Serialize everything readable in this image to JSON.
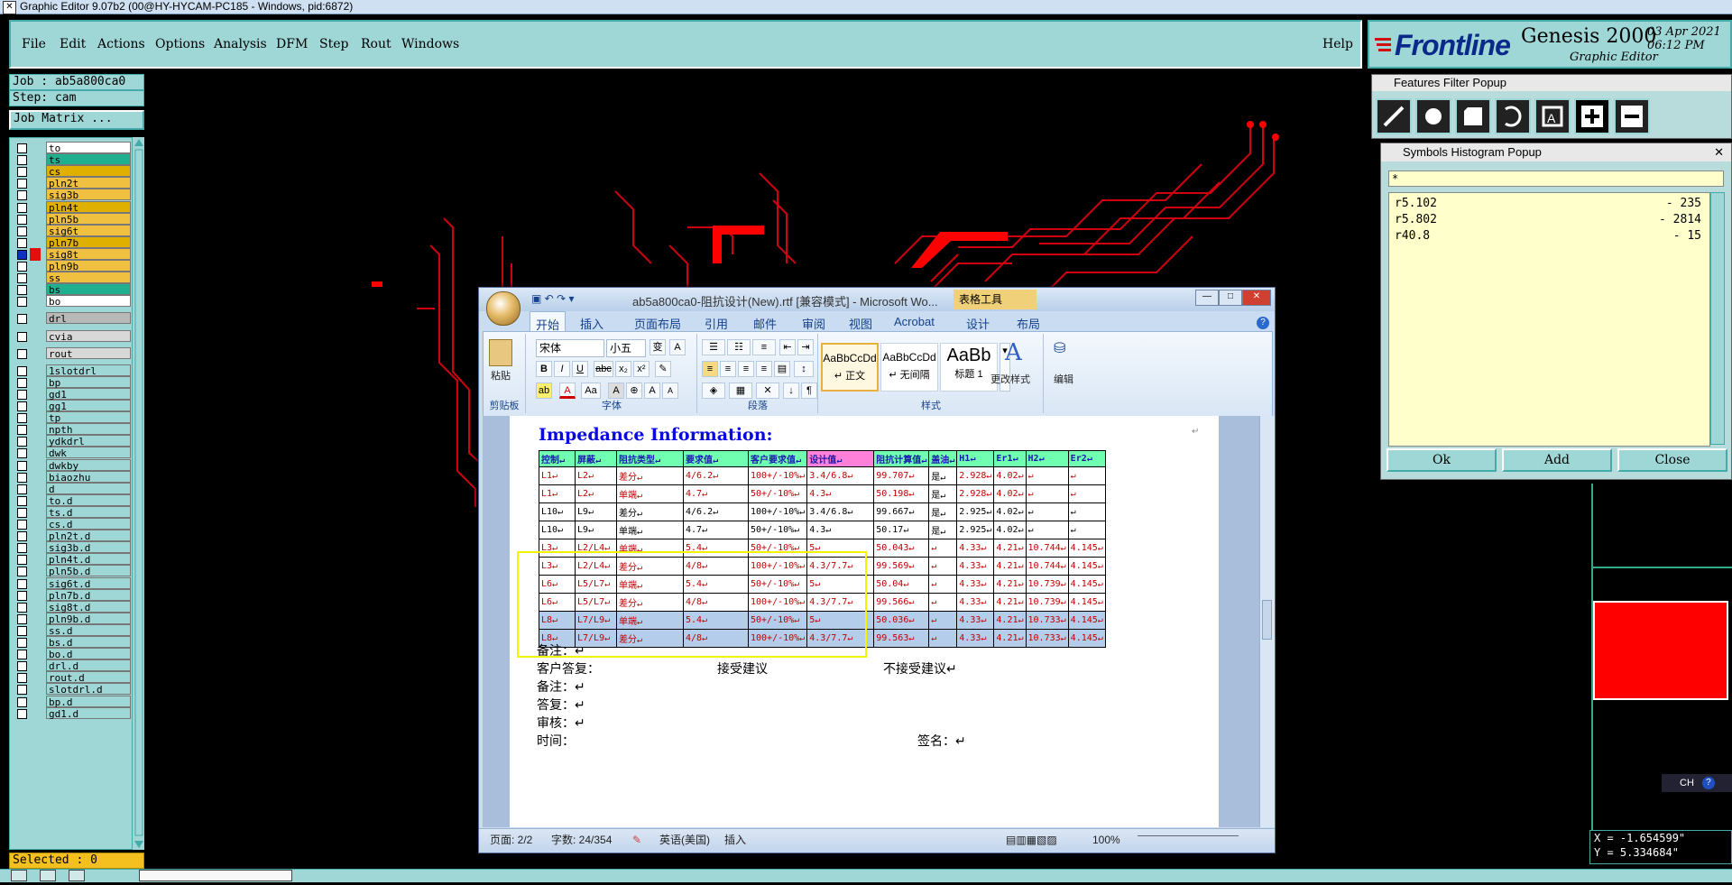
{
  "titlebar": {
    "title": "Graphic Editor 9.07b2 (00@HY-HYCAM-PC185 - Windows, pid:6872)"
  },
  "menu": {
    "items": [
      "File",
      "Edit",
      "Actions",
      "Options",
      "Analysis",
      "DFM",
      "Step",
      "Rout",
      "Windows"
    ],
    "help": "Help"
  },
  "logo": {
    "brand": "Frontline",
    "product": "Genesis 2000",
    "subtitle": "Graphic Editor",
    "date": "03 Apr 2021",
    "time": "06:12 PM"
  },
  "job": {
    "job_label": "Job : ab5a800ca0",
    "step_label": "Step: cam",
    "matrix_button": "Job Matrix ..."
  },
  "layers": [
    {
      "name": "to",
      "color": "#ffffff",
      "mark": "⬋"
    },
    {
      "name": "ts",
      "color": "#20b090",
      "mark": ""
    },
    {
      "name": "cs",
      "color": "#e0b000",
      "mark": "⬋"
    },
    {
      "name": "pln2t",
      "color": "#f0c040",
      "mark": ""
    },
    {
      "name": "sig3b",
      "color": "#f0c040",
      "mark": ""
    },
    {
      "name": "pln4t",
      "color": "#e0b000",
      "mark": ""
    },
    {
      "name": "pln5b",
      "color": "#f0c040",
      "mark": ""
    },
    {
      "name": "sig6t",
      "color": "#f0c040",
      "mark": ""
    },
    {
      "name": "pln7b",
      "color": "#e0b000",
      "mark": ""
    },
    {
      "name": "sig8t",
      "color": "#f0c040",
      "mark": "■"
    },
    {
      "name": "pln9b",
      "color": "#f0c040",
      "mark": ""
    },
    {
      "name": "ss",
      "color": "#f0c040",
      "mark": "⬋"
    },
    {
      "name": "bs",
      "color": "#20b090",
      "mark": ""
    },
    {
      "name": "bo",
      "color": "#ffffff",
      "mark": "⬋"
    },
    {
      "name": "drl",
      "color": "#b8b8b8",
      "mark": ""
    },
    {
      "name": "cvia",
      "color": "#d8d8d8",
      "mark": ""
    },
    {
      "name": "rout",
      "color": "#d8d8d8",
      "mark": ""
    },
    {
      "name": "1slotdrl",
      "color": "#9fd6d6",
      "mark": ""
    },
    {
      "name": "bp",
      "color": "#9fd6d6",
      "mark": ""
    },
    {
      "name": "gd1",
      "color": "#9fd6d6",
      "mark": "⬋"
    },
    {
      "name": "gg1",
      "color": "#9fd6d6",
      "mark": ""
    },
    {
      "name": "tp",
      "color": "#9fd6d6",
      "mark": ""
    },
    {
      "name": "npth",
      "color": "#9fd6d6",
      "mark": ""
    },
    {
      "name": "ydkdrl",
      "color": "#9fd6d6",
      "mark": ""
    },
    {
      "name": "dwk",
      "color": "#9fd6d6",
      "mark": ""
    },
    {
      "name": "dwkby",
      "color": "#9fd6d6",
      "mark": ""
    },
    {
      "name": "biaozhu",
      "color": "#9fd6d6",
      "mark": ""
    },
    {
      "name": "d",
      "color": "#9fd6d6",
      "mark": ""
    },
    {
      "name": "to.d",
      "color": "#9fd6d6",
      "mark": "⬋"
    },
    {
      "name": "ts.d",
      "color": "#9fd6d6",
      "mark": ""
    },
    {
      "name": "cs.d",
      "color": "#9fd6d6",
      "mark": "⬋"
    },
    {
      "name": "pln2t.d",
      "color": "#9fd6d6",
      "mark": ""
    },
    {
      "name": "sig3b.d",
      "color": "#9fd6d6",
      "mark": ""
    },
    {
      "name": "pln4t.d",
      "color": "#9fd6d6",
      "mark": ""
    },
    {
      "name": "pln5b.d",
      "color": "#9fd6d6",
      "mark": ""
    },
    {
      "name": "sig6t.d",
      "color": "#9fd6d6",
      "mark": ""
    },
    {
      "name": "pln7b.d",
      "color": "#9fd6d6",
      "mark": ""
    },
    {
      "name": "sig8t.d",
      "color": "#9fd6d6",
      "mark": ""
    },
    {
      "name": "pln9b.d",
      "color": "#9fd6d6",
      "mark": ""
    },
    {
      "name": "ss.d",
      "color": "#9fd6d6",
      "mark": "⬋"
    },
    {
      "name": "bs.d",
      "color": "#9fd6d6",
      "mark": ""
    },
    {
      "name": "bo.d",
      "color": "#9fd6d6",
      "mark": "⬋"
    },
    {
      "name": "drl.d",
      "color": "#9fd6d6",
      "mark": ""
    },
    {
      "name": "rout.d",
      "color": "#9fd6d6",
      "mark": ""
    },
    {
      "name": "slotdrl.d",
      "color": "#9fd6d6",
      "mark": ""
    },
    {
      "name": "bp.d",
      "color": "#9fd6d6",
      "mark": ""
    },
    {
      "name": "gd1.d",
      "color": "#9fd6d6",
      "mark": "⬋"
    }
  ],
  "selected_label": "Selected : 0",
  "features_filter": {
    "title": "Features Filter Popup"
  },
  "symbols_histogram": {
    "title": "Symbols Histogram Popup",
    "filter": "*",
    "rows": [
      {
        "symbol": "r5.102",
        "count": "- 235"
      },
      {
        "symbol": "r5.802",
        "count": "- 2814"
      },
      {
        "symbol": "r40.8",
        "count": "- 15"
      }
    ],
    "ok": "Ok",
    "add": "Add",
    "close": "Close"
  },
  "coords": {
    "x": "X = -1.654599\"",
    "y": "Y = 5.334684\""
  },
  "ch_widget": "CH",
  "word": {
    "title": "ab5a800ca0-阻抗设计(New).rtf [兼容模式] - Microsoft Wo...",
    "table_tools": "表格工具",
    "tabs": [
      "开始",
      "插入",
      "页面布局",
      "引用",
      "邮件",
      "审阅",
      "视图",
      "Acrobat",
      "设计",
      "布局"
    ],
    "ribbon": {
      "paste": "粘贴",
      "clipboard": "剪贴板",
      "font_name": "宋体",
      "font_size": "小五",
      "font": "字体",
      "paragraph": "段落",
      "styles": [
        {
          "preview": "AaBbCcDd",
          "name": "↵ 正文"
        },
        {
          "preview": "AaBbCcDd",
          "name": "↵ 无间隔"
        },
        {
          "preview": "AaBb",
          "name": "标题 1"
        }
      ],
      "change_styles": "更改样式",
      "styles_group": "样式",
      "edit": "编辑"
    },
    "doc_title": "Impedance Information:",
    "table_header": [
      "控制↵",
      "屏蔽↵",
      "阻抗类型↵",
      "要求值↵",
      "客户要求值↵",
      "设计值↵",
      "阻抗计算值↵",
      "盖油↵",
      "H1↵",
      "Er1↵",
      "H2↵",
      "Er2↵"
    ],
    "table_rows": [
      {
        "style": "rd",
        "cells": [
          "L1↵",
          "L2↵",
          "差分↵",
          "4/6.2↵",
          "100+/-10%↵",
          "3.4/6.8↵",
          "99.707↵",
          "是↵",
          "2.928↵",
          "4.02↵",
          "↵",
          "↵"
        ]
      },
      {
        "style": "rd",
        "cells": [
          "L1↵",
          "L2↵",
          "单端↵",
          "4.7↵",
          "50+/-10%↵",
          "4.3↵",
          "50.198↵",
          "是↵",
          "2.928↵",
          "4.02↵",
          "↵",
          "↵"
        ]
      },
      {
        "style": "bk",
        "cells": [
          "L10↵",
          "L9↵",
          "差分↵",
          "4/6.2↵",
          "100+/-10%↵",
          "3.4/6.8↵",
          "99.667↵",
          "是↵",
          "2.925↵",
          "4.02↵",
          "↵",
          "↵"
        ]
      },
      {
        "style": "bk",
        "cells": [
          "L10↵",
          "L9↵",
          "单端↵",
          "4.7↵",
          "50+/-10%↵",
          "4.3↵",
          "50.17↵",
          "是↵",
          "2.925↵",
          "4.02↵",
          "↵",
          "↵"
        ]
      },
      {
        "style": "rd",
        "cells": [
          "L3↵",
          "L2/L4↵",
          "单端↵",
          "5.4↵",
          "50+/-10%↵",
          "5↵",
          "50.043↵",
          "↵",
          "4.33↵",
          "4.21↵",
          "10.744↵",
          "4.145↵"
        ]
      },
      {
        "style": "rd",
        "cells": [
          "L3↵",
          "L2/L4↵",
          "差分↵",
          "4/8↵",
          "100+/-10%↵",
          "4.3/7.7↵",
          "99.569↵",
          "↵",
          "4.33↵",
          "4.21↵",
          "10.744↵",
          "4.145↵"
        ]
      },
      {
        "style": "rd",
        "cells": [
          "L6↵",
          "L5/L7↵",
          "单端↵",
          "5.4↵",
          "50+/-10%↵",
          "5↵",
          "50.04↵",
          "↵",
          "4.33↵",
          "4.21↵",
          "10.739↵",
          "4.145↵"
        ]
      },
      {
        "style": "rd",
        "cells": [
          "L6↵",
          "L5/L7↵",
          "差分↵",
          "4/8↵",
          "100+/-10%↵",
          "4.3/7.7↵",
          "99.566↵",
          "↵",
          "4.33↵",
          "4.21↵",
          "10.739↵",
          "4.145↵"
        ]
      },
      {
        "style": "hl",
        "cells": [
          "L8↵",
          "L7/L9↵",
          "单端↵",
          "5.4↵",
          "50+/-10%↵",
          "5↵",
          "50.036↵",
          "↵",
          "4.33↵",
          "4.21↵",
          "10.733↵",
          "4.145↵"
        ]
      },
      {
        "style": "hl",
        "cells": [
          "L8↵",
          "L7/L9↵",
          "差分↵",
          "4/8↵",
          "100+/-10%↵",
          "4.3/7.7↵",
          "99.563↵",
          "↵",
          "4.33↵",
          "4.21↵",
          "10.733↵",
          "4.145↵"
        ]
      }
    ],
    "notes": {
      "remark1": "备注：↵",
      "customer_reply": "客户答复：",
      "accept": "接受建议",
      "reject": "不接受建议↵",
      "remark2": "备注：↵",
      "reply": "答复：↵",
      "review": "审核：↵",
      "time": "时间：",
      "sign": "签名：↵"
    },
    "status": {
      "page": "页面: 2/2",
      "words": "字数: 24/354",
      "lang": "英语(美国)",
      "mode": "插入",
      "zoom": "100%"
    }
  }
}
